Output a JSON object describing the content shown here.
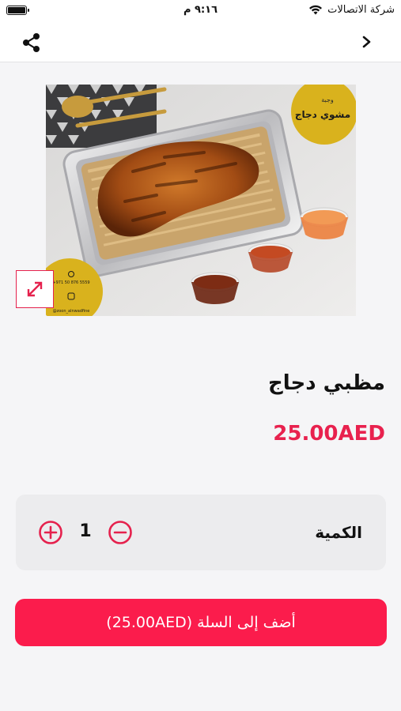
{
  "status_bar": {
    "carrier": "شركة الاتصالات",
    "time": "٩:١٦ م"
  },
  "nav": {
    "share_icon": "share-icon",
    "back_icon": "chevron-right-icon"
  },
  "hero": {
    "badge_top_small": "وجبة",
    "badge_top_title": "مشوي دجاج",
    "badge_bottom_phone": "+971 50 876 5559",
    "badge_bottom_handle": "@zoon_alnwadfine"
  },
  "product": {
    "title": "مظبي دجاج",
    "price": "25.00AED"
  },
  "quantity": {
    "label": "الكمية",
    "value": "1"
  },
  "cart": {
    "button_label": "أضف إلى السلة (25.00AED)"
  },
  "colors": {
    "accent": "#fb1c4c",
    "price": "#e8214e"
  }
}
